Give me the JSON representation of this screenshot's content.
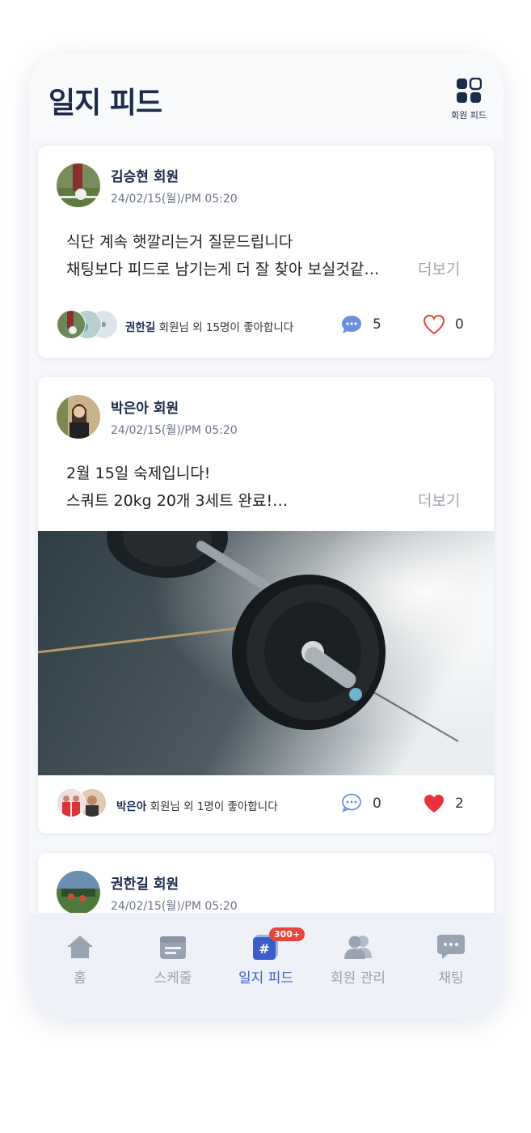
{
  "header": {
    "title": "일지 피드",
    "member_feed_label": "회원 피드"
  },
  "posts": [
    {
      "name": "김승현 회원",
      "date": "24/02/15(월)/PM 05:20",
      "lines": [
        "식단 계속 햇깔리는거 질문드립니다",
        "채팅보다 피드로 남기는게 더 잘 찾아 보실것같…"
      ],
      "more": "더보기",
      "likes_name": "권한길",
      "likes_suffix": " 회원님 외 15명이 좋아합니다",
      "comments": "5",
      "hearts": "0"
    },
    {
      "name": "박은아 회원",
      "date": "24/02/15(월)/PM 05:20",
      "lines": [
        "2월 15일 숙제입니다!",
        "스쿼트 20kg 20개 3세트 완료!…"
      ],
      "more": "더보기",
      "likes_name": "박은아",
      "likes_suffix": " 회원님 외 1명이 좋아합니다",
      "comments": "0",
      "hearts": "2"
    },
    {
      "name": "권한길 회원",
      "date": "24/02/15(월)/PM 05:20"
    }
  ],
  "nav": {
    "items": [
      "홈",
      "스케줄",
      "일지 피드",
      "회원 관리",
      "채팅"
    ],
    "badge": "300+",
    "active_color": "#3a5fc8",
    "inactive_color": "#9aa3b1"
  }
}
